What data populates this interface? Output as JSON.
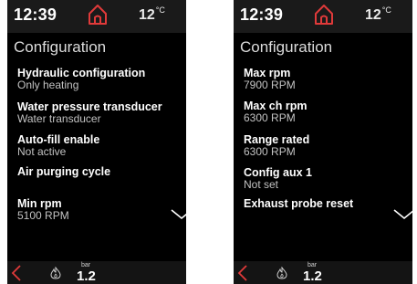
{
  "status": {
    "time": "12:39",
    "temperature": "12",
    "temperature_unit": "°C"
  },
  "page_title": "Configuration",
  "left_screen": {
    "items": [
      {
        "label": "Hydraulic configuration",
        "value": "Only heating"
      },
      {
        "label": "Water pressure transducer",
        "value": "Water transducer"
      },
      {
        "label": "Auto-fill enable",
        "value": "Not active"
      },
      {
        "label": "Air purging cycle"
      },
      {
        "label": "Min rpm",
        "value": "5100 RPM"
      }
    ]
  },
  "right_screen": {
    "items": [
      {
        "label": "Max rpm",
        "value": "7900 RPM"
      },
      {
        "label": "Max ch rpm",
        "value": "6300 RPM"
      },
      {
        "label": "Range rated",
        "value": "6300 RPM"
      },
      {
        "label": "Config aux 1",
        "value": "Not set"
      },
      {
        "label": "Exhaust probe reset"
      }
    ]
  },
  "bottom": {
    "pressure_unit": "bar",
    "pressure_value": "1.2"
  },
  "colors": {
    "accent": "#e03a3a",
    "background": "#000000",
    "bar_bg": "#1a1a1a"
  },
  "icons": {
    "home": "home-icon",
    "back": "back-icon",
    "flame": "flame-icon",
    "more": "chevron-down-icon"
  }
}
